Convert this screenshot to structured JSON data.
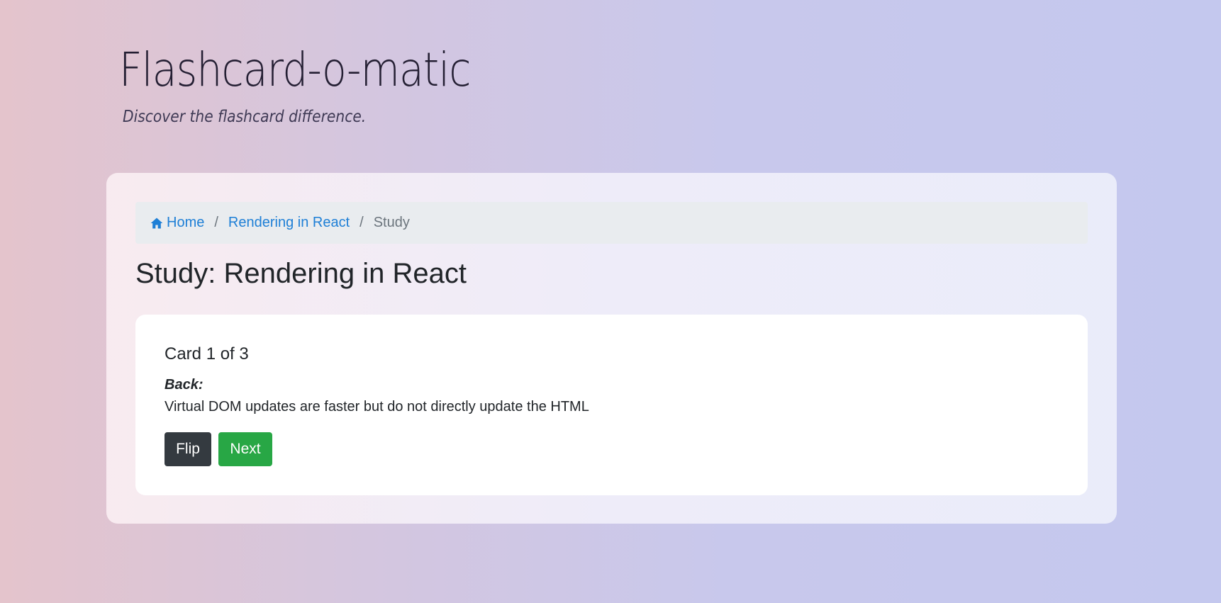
{
  "header": {
    "title": "Flashcard-o-matic",
    "tagline": "Discover the flashcard difference."
  },
  "breadcrumb": {
    "items": [
      {
        "label": "Home",
        "icon": "home-icon"
      },
      {
        "label": "Rendering in React"
      },
      {
        "label": "Study"
      }
    ],
    "separator": "/"
  },
  "page": {
    "title": "Study: Rendering in React"
  },
  "card": {
    "title": "Card 1 of 3",
    "side_label": "Back:",
    "text": "Virtual DOM updates are faster but do not directly update the HTML"
  },
  "actions": {
    "flip_label": "Flip",
    "next_label": "Next"
  },
  "colors": {
    "link": "#1e7fd6",
    "flip_button": "#343a40",
    "next_button": "#28a745"
  }
}
